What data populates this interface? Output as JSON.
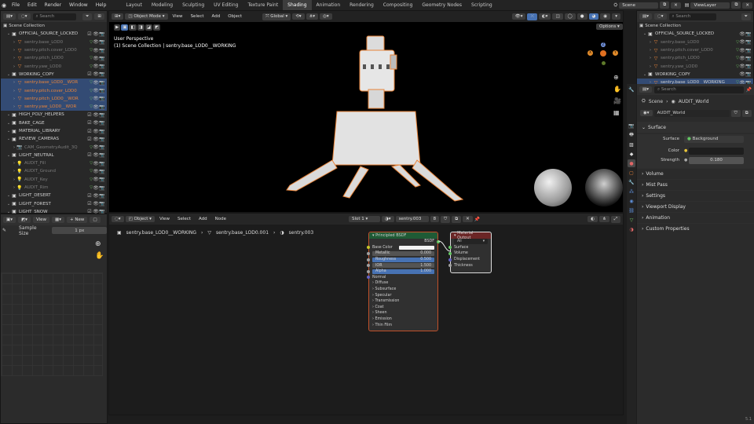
{
  "menu": [
    "File",
    "Edit",
    "Render",
    "Window",
    "Help"
  ],
  "workspaces": [
    {
      "label": "Layout",
      "active": false
    },
    {
      "label": "Modeling",
      "active": false
    },
    {
      "label": "Sculpting",
      "active": false
    },
    {
      "label": "UV Editing",
      "active": false
    },
    {
      "label": "Texture Paint",
      "active": false
    },
    {
      "label": "Shading",
      "active": true
    },
    {
      "label": "Animation",
      "active": false
    },
    {
      "label": "Rendering",
      "active": false
    },
    {
      "label": "Compositing",
      "active": false
    },
    {
      "label": "Geometry Nodes",
      "active": false
    },
    {
      "label": "Scripting",
      "active": false
    }
  ],
  "top_right": {
    "scene": "Scene",
    "view_layer": "ViewLayer"
  },
  "outliner_left": {
    "search_placeholder": "Search",
    "root": "Scene Collection",
    "rows": [
      {
        "label": "OFFICIAL_SOURCE_LOCKED",
        "indent": 1,
        "kind": "collection",
        "style": "normal",
        "sel": false
      },
      {
        "label": "sentry.base_LOD0",
        "indent": 2,
        "kind": "object",
        "style": "dim",
        "sel": false
      },
      {
        "label": "sentry.pitch.cover_LOD0",
        "indent": 2,
        "kind": "object",
        "style": "dim",
        "sel": false
      },
      {
        "label": "sentry.pitch_LOD0",
        "indent": 2,
        "kind": "object",
        "style": "dim",
        "sel": false
      },
      {
        "label": "sentry.yaw_LOD0",
        "indent": 2,
        "kind": "object",
        "style": "dim",
        "sel": false
      },
      {
        "label": "WORKING_COPY",
        "indent": 1,
        "kind": "collection",
        "style": "normal",
        "sel": false
      },
      {
        "label": "sentry.base_LOD0__WOR",
        "indent": 2,
        "kind": "object",
        "style": "orange",
        "sel": true
      },
      {
        "label": "sentry.pitch.cover_LOD0",
        "indent": 2,
        "kind": "object",
        "style": "orange",
        "sel": true
      },
      {
        "label": "sentry.pitch_LOD0__WOR",
        "indent": 2,
        "kind": "object",
        "style": "orange",
        "sel": true
      },
      {
        "label": "sentry.yaw_LOD0__WOR",
        "indent": 2,
        "kind": "object",
        "style": "orange",
        "sel": true
      },
      {
        "label": "HIGH_POLY_HELPERS",
        "indent": 1,
        "kind": "collection",
        "style": "normal",
        "sel": false
      },
      {
        "label": "BAKE_CAGE",
        "indent": 1,
        "kind": "collection",
        "style": "normal",
        "sel": false
      },
      {
        "label": "MATERIAL_LIBRARY",
        "indent": 1,
        "kind": "collection",
        "style": "normal",
        "sel": false
      },
      {
        "label": "REVIEW_CAMERAS",
        "indent": 1,
        "kind": "collection",
        "style": "normal",
        "sel": false
      },
      {
        "label": "CAM_GeometryAudit_3Q",
        "indent": 2,
        "kind": "camera",
        "style": "dim",
        "sel": false
      },
      {
        "label": "LIGHT_NEUTRAL",
        "indent": 1,
        "kind": "collection",
        "style": "normal",
        "sel": false
      },
      {
        "label": "AUDIT_Fill",
        "indent": 2,
        "kind": "light",
        "style": "dim",
        "sel": false
      },
      {
        "label": "AUDIT_Ground",
        "indent": 2,
        "kind": "light",
        "style": "dim",
        "sel": false
      },
      {
        "label": "AUDIT_Key",
        "indent": 2,
        "kind": "light",
        "style": "dim",
        "sel": false
      },
      {
        "label": "AUDIT_Rim",
        "indent": 2,
        "kind": "light",
        "style": "dim",
        "sel": false
      },
      {
        "label": "LIGHT_DESERT",
        "indent": 1,
        "kind": "collection",
        "style": "normal",
        "sel": false
      },
      {
        "label": "LIGHT_FOREST",
        "indent": 1,
        "kind": "collection",
        "style": "normal",
        "sel": false
      },
      {
        "label": "LIGHT_SNOW",
        "indent": 1,
        "kind": "collection",
        "style": "normal",
        "sel": false
      }
    ]
  },
  "outliner_right": {
    "search_placeholder": "Search",
    "root": "Scene Collection",
    "rows": [
      {
        "label": "OFFICIAL_SOURCE_LOCKED",
        "indent": 1,
        "kind": "collection",
        "style": "normal",
        "sel": false
      },
      {
        "label": "sentry.base_LOD0",
        "indent": 2,
        "kind": "object",
        "style": "dim",
        "sel": false
      },
      {
        "label": "sentry.pitch.cover_LOD0",
        "indent": 2,
        "kind": "object",
        "style": "dim",
        "sel": false
      },
      {
        "label": "sentry.pitch_LOD0",
        "indent": 2,
        "kind": "object",
        "style": "dim",
        "sel": false
      },
      {
        "label": "sentry.yaw_LOD0",
        "indent": 2,
        "kind": "object",
        "style": "dim",
        "sel": false
      },
      {
        "label": "WORKING_COPY",
        "indent": 1,
        "kind": "collection",
        "style": "normal",
        "sel": false
      },
      {
        "label": "sentry.base_LOD0__WORKING",
        "indent": 2,
        "kind": "object",
        "style": "normal",
        "sel": true
      }
    ]
  },
  "image_editor": {
    "view": "View",
    "new": "New",
    "sample_size_label": "Sample Size",
    "sample_size_value": "1 px"
  },
  "viewport": {
    "mode": "Object Mode",
    "menus": [
      "View",
      "Select",
      "Add",
      "Object"
    ],
    "transform": "Global",
    "options": "Options",
    "overlay_title": "User Perspective",
    "overlay_sub": "(1) Scene Collection | sentry.base_LOD0__WORKING",
    "gizmo": {
      "x": "X",
      "y": "Y",
      "z": "Z"
    }
  },
  "node_editor": {
    "type": "Object",
    "menus": [
      "View",
      "Select",
      "Add",
      "Node"
    ],
    "slot": "Slot 1",
    "material": "sentry.003",
    "users": "8",
    "breadcrumb": [
      "sentry.base_LOD0__WORKING",
      "sentry.base_LOD0.001",
      "sentry.003"
    ],
    "bsdf": {
      "title": "Principled BSDF",
      "output": "BSDF",
      "fields": [
        {
          "label": "Base Color",
          "value": "",
          "kind": "color"
        },
        {
          "label": "Metallic",
          "value": "0.000",
          "kind": "plain"
        },
        {
          "label": "Roughness",
          "value": "0.500",
          "kind": "blue"
        },
        {
          "label": "IOR",
          "value": "1.500",
          "kind": "plain"
        },
        {
          "label": "Alpha",
          "value": "1.000",
          "kind": "blue"
        },
        {
          "label": "Normal",
          "value": "",
          "kind": "socket"
        }
      ],
      "panels": [
        "Diffuse",
        "Subsurface",
        "Specular",
        "Transmission",
        "Coat",
        "Sheen",
        "Emission",
        "Thin Film"
      ]
    },
    "output": {
      "title": "Material Output",
      "target": "All",
      "inputs": [
        "Surface",
        "Volume",
        "Displacement",
        "Thickness"
      ]
    }
  },
  "properties": {
    "search_placeholder": "Search",
    "breadcrumb": [
      "Scene",
      "AUDIT_World"
    ],
    "world": "AUDIT_World",
    "surface_section": "Surface",
    "surface_label": "Surface",
    "surface_value": "Background",
    "color_label": "Color",
    "strength_label": "Strength",
    "strength_value": "0.180",
    "sections": [
      "Volume",
      "Mist Pass",
      "Settings",
      "Viewport Display",
      "Animation",
      "Custom Properties"
    ]
  },
  "status": {
    "version": "5.1"
  },
  "colors": {
    "accent": "#4772b3",
    "selected_orange": "#e8843a",
    "bsdf_header": "#1f5a35",
    "output_header": "#6b2626"
  }
}
